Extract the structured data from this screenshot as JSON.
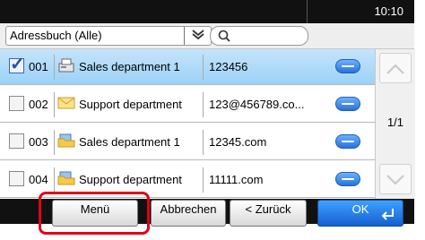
{
  "header": {
    "time": "10:10"
  },
  "filter": {
    "address_book": "Adressbuch (Alle)",
    "dropdown_glyph": "▾",
    "search_placeholder": ""
  },
  "rows": [
    {
      "number": "001",
      "icon": "fax-icon",
      "name": "Sales department 1",
      "address": "123456",
      "checked": true
    },
    {
      "number": "002",
      "icon": "email-icon",
      "name": "Support department",
      "address": "123@456789.co...",
      "checked": false
    },
    {
      "number": "003",
      "icon": "folder-icon",
      "name": "Sales department 1",
      "address": "12345.com",
      "checked": false
    },
    {
      "number": "004",
      "icon": "folder-icon",
      "name": "Support department",
      "address": "11111.com",
      "checked": false
    }
  ],
  "pagination": {
    "page_label": "1/1"
  },
  "buttons": {
    "menu": "Menü",
    "cancel": "Abbrechen",
    "back": "< Zurück",
    "ok": "OK"
  },
  "colors": {
    "selected_row": "#9cd1f7",
    "highlight": "#e0001a",
    "ok_button": "#1560d0"
  }
}
